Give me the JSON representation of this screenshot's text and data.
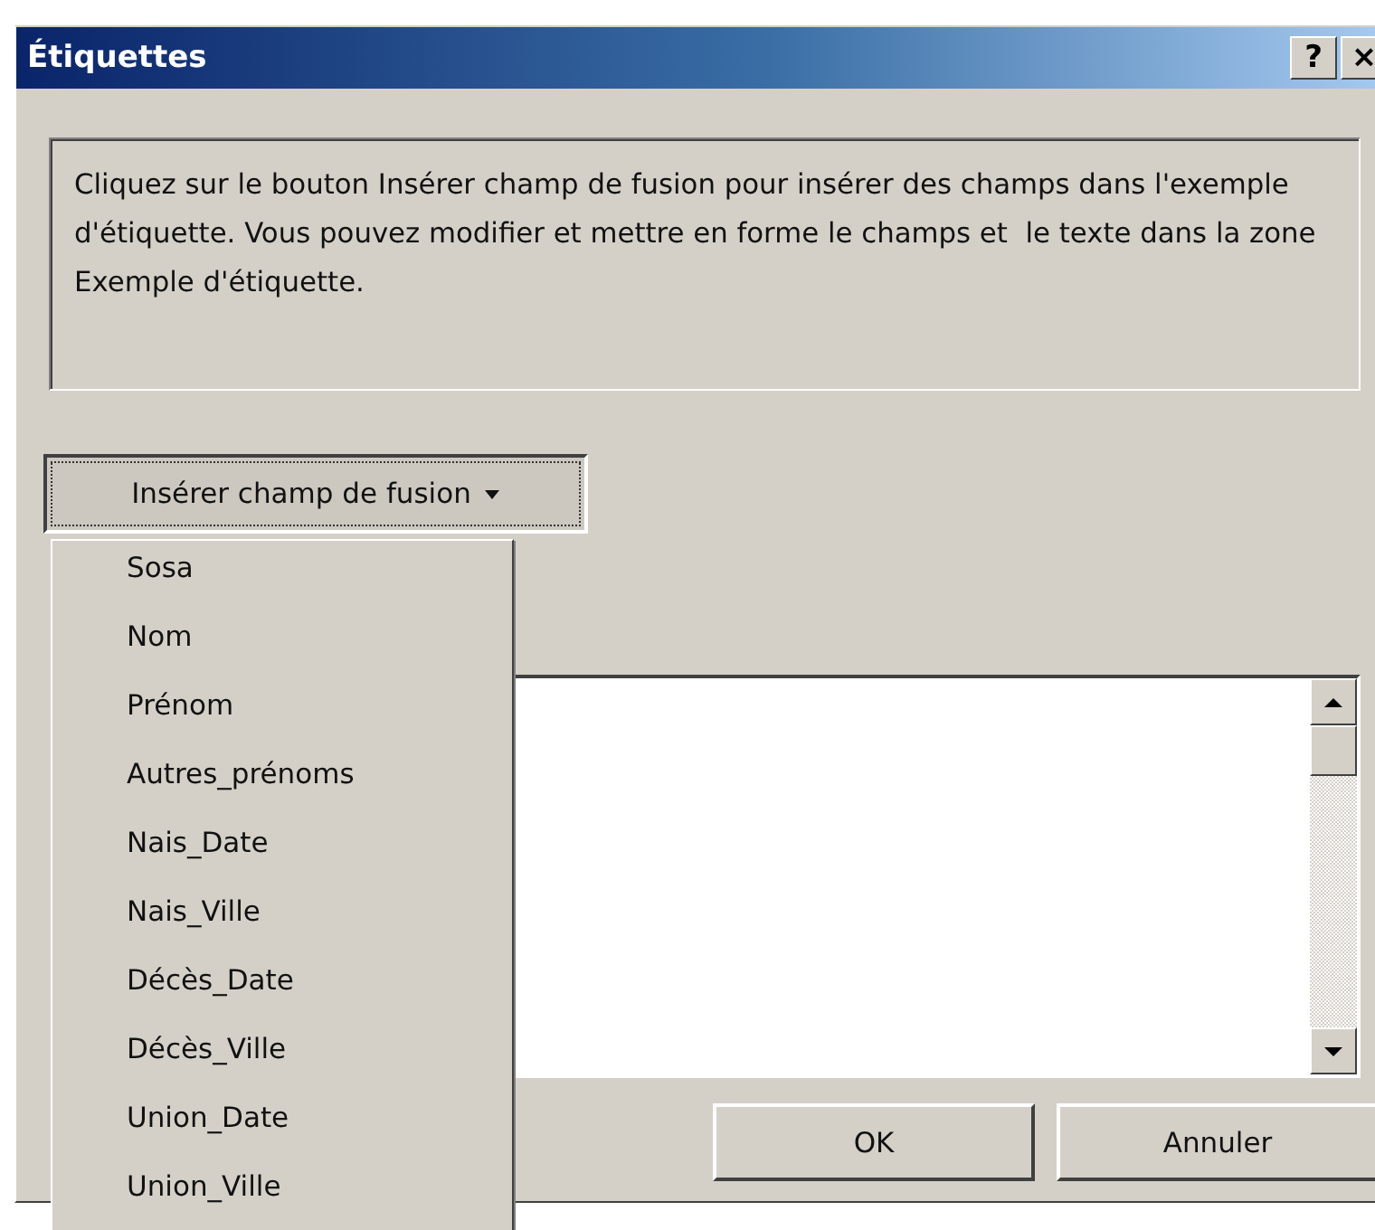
{
  "window": {
    "title": "Étiquettes",
    "help_button": "?",
    "close_button": "×"
  },
  "instructions": "Cliquez sur le bouton Insérer champ de fusion pour insérer des champs dans l'exemple d'étiquette. Vous pouvez modifier et mettre en forme le champs et  le texte dans la zone Exemple d'étiquette.",
  "insert_button": {
    "label": "Insérer champ de fusion",
    "expanded": true
  },
  "menu_items": [
    {
      "label": "Sosa"
    },
    {
      "label": "Nom"
    },
    {
      "label": "Prénom"
    },
    {
      "label": "Autres_prénoms"
    },
    {
      "label": "Nais_Date"
    },
    {
      "label": "Nais_Ville"
    },
    {
      "label": "Décès_Date"
    },
    {
      "label": "Décès_Ville"
    },
    {
      "label": "Union_Date"
    },
    {
      "label": "Union_Ville"
    }
  ],
  "buttons": [
    {
      "label": "OK"
    },
    {
      "label": "Annuler"
    }
  ]
}
